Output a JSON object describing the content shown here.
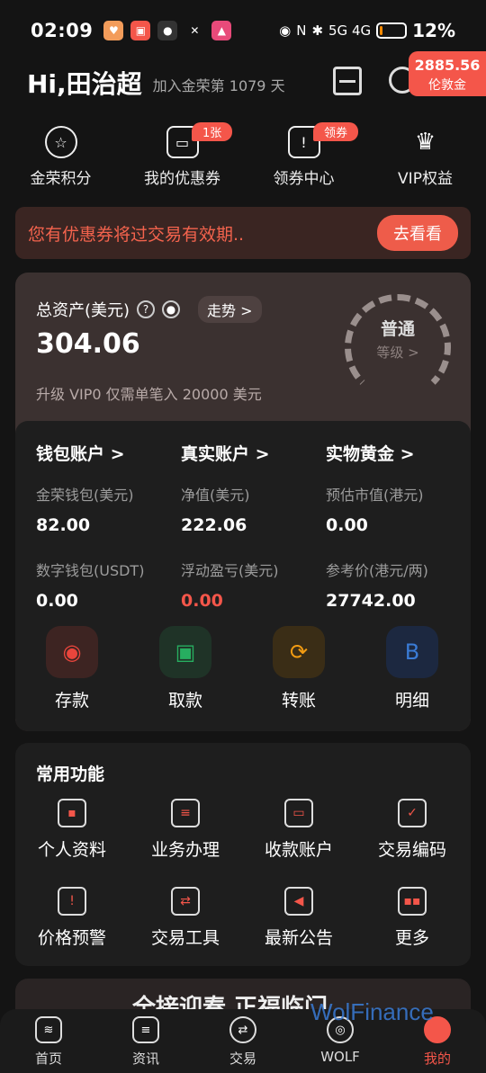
{
  "status": {
    "time": "02:09",
    "indicators": "5G 4G",
    "battery": "12%",
    "battery_level": 0.12
  },
  "header": {
    "greeting": "Hi,田治超",
    "join_text": "加入金荣第 1079 天",
    "gold_amount": "2885.56",
    "gold_unit": "伦敦金"
  },
  "quick": [
    {
      "label": "金荣积分",
      "icon": "star-icon",
      "tag": ""
    },
    {
      "label": "我的优惠券",
      "icon": "coupon-icon",
      "tag": "1张"
    },
    {
      "label": "领券中心",
      "icon": "coupon-center-icon",
      "tag": "领券"
    },
    {
      "label": "VIP权益",
      "icon": "crown-icon",
      "tag": ""
    }
  ],
  "notice": {
    "text": "您有优惠券将过交易有效期..",
    "button": "去看看"
  },
  "asset": {
    "label": "总资产(美元)",
    "help": "?",
    "trend": "走势 >",
    "total": "304.06",
    "upgrade": "升级 VIP0 仅需单笔入 20000 美元",
    "level": "普通",
    "level_sub": "等级 >"
  },
  "accounts": [
    {
      "header": "钱包账户 >",
      "k1": "金荣钱包(美元)",
      "v1": "82.00",
      "k2": "数字钱包(USDT)",
      "v2": "0.00"
    },
    {
      "header": "真实账户 >",
      "k1": "净值(美元)",
      "v1": "222.06",
      "k2": "浮动盈亏(美元)",
      "v2": "0.00"
    },
    {
      "header": "实物黄金 >",
      "k1": "预估市值(港元)",
      "v1": "0.00",
      "k2": "参考价(港元/两)",
      "v2": "27742.00"
    }
  ],
  "actions": [
    {
      "label": "存款",
      "icon": "deposit-icon",
      "color": "#e8453c"
    },
    {
      "label": "取款",
      "icon": "withdraw-icon",
      "color": "#27ae60"
    },
    {
      "label": "转账",
      "icon": "transfer-icon",
      "color": "#f39c12"
    },
    {
      "label": "明细",
      "icon": "details-icon",
      "color": "#3a7bd5"
    }
  ],
  "common": {
    "title": "常用功能",
    "items": [
      {
        "label": "个人资料",
        "icon": "profile-icon"
      },
      {
        "label": "业务办理",
        "icon": "business-icon"
      },
      {
        "label": "收款账户",
        "icon": "card-icon"
      },
      {
        "label": "交易编码",
        "icon": "shield-icon"
      },
      {
        "label": "价格预警",
        "icon": "alarm-icon"
      },
      {
        "label": "交易工具",
        "icon": "tools-icon"
      },
      {
        "label": "最新公告",
        "icon": "megaphone-icon"
      },
      {
        "label": "更多",
        "icon": "more-icon"
      }
    ]
  },
  "promo": {
    "text": "全接迎春 正福临门"
  },
  "watermark": "WolFinance",
  "tabs": [
    {
      "label": "首页",
      "icon": "home-icon",
      "active": false
    },
    {
      "label": "资讯",
      "icon": "news-icon",
      "active": false
    },
    {
      "label": "交易",
      "icon": "trade-icon",
      "active": false
    },
    {
      "label": "WOLF",
      "icon": "wolf-icon",
      "active": false
    },
    {
      "label": "我的",
      "icon": "me-icon",
      "active": true
    }
  ]
}
